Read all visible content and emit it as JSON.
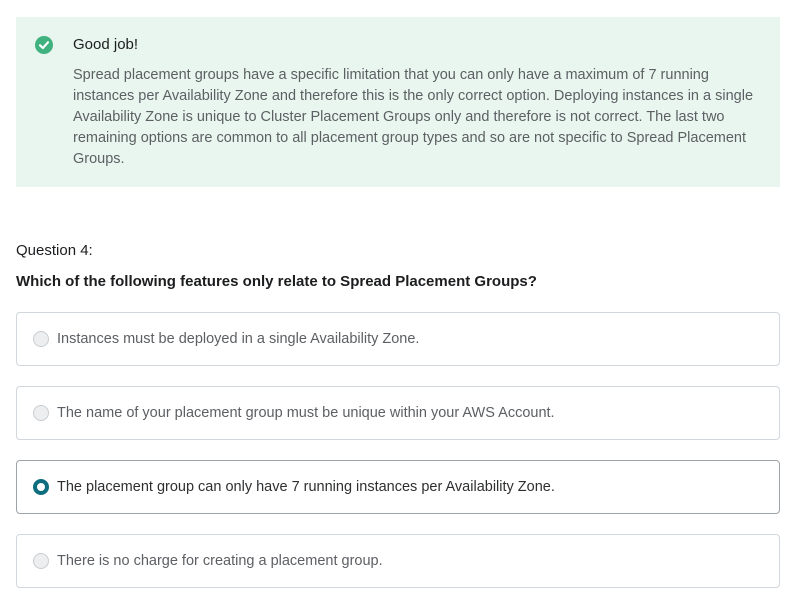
{
  "feedback": {
    "title": "Good job!",
    "explanation": "Spread placement groups have a specific limitation that you can only have a maximum of 7 running instances per Availability Zone and therefore this is the only correct option. Deploying instances in a single Availability Zone is unique to Cluster Placement Groups only and therefore is not correct. The last two remaining options are common to all placement group types and so are not specific to Spread Placement Groups.",
    "icon": "check-circle-icon",
    "color": "#3fb27f",
    "background": "#e9f6ef"
  },
  "question": {
    "number": "Question 4:",
    "text": "Which of the following features only relate to Spread Placement Groups?",
    "options": [
      {
        "label": "Instances must be deployed in a single Availability Zone.",
        "selected": false
      },
      {
        "label": "The name of your placement group must be unique within your AWS Account.",
        "selected": false
      },
      {
        "label": "The placement group can only have 7 running instances per Availability Zone.",
        "selected": true
      },
      {
        "label": "There is no charge for creating a placement group.",
        "selected": false
      }
    ],
    "selected_color": "#0f6e7d"
  }
}
